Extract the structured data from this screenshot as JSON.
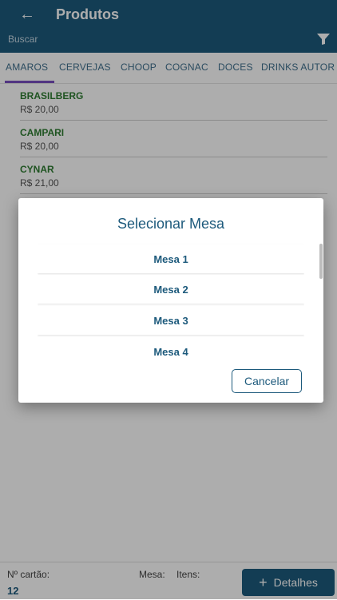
{
  "header": {
    "title": "Produtos",
    "back_icon": "←",
    "search_placeholder": "Buscar",
    "filter_icon": "filter-icon"
  },
  "tabs": [
    {
      "label": "AMAROS",
      "active": true
    },
    {
      "label": "CERVEJAS"
    },
    {
      "label": "CHOOP"
    },
    {
      "label": "COGNAC"
    },
    {
      "label": "DOCES"
    },
    {
      "label": "DRINKS AUTOR"
    }
  ],
  "products": [
    {
      "name": "BRASILBERG",
      "price": "R$ 20,00"
    },
    {
      "name": "CAMPARI",
      "price": "R$ 20,00"
    },
    {
      "name": "CYNAR",
      "price": "R$ 21,00"
    }
  ],
  "footer": {
    "cartao_label": "Nº cartão:",
    "cartao_value": "12",
    "mesa_label": "Mesa:",
    "itens_label": "Itens:",
    "detalhes_icon": "+",
    "detalhes_label": "Detalhes"
  },
  "dialog": {
    "title": "Selecionar Mesa",
    "options": [
      "Mesa 1",
      "Mesa 2",
      "Mesa 3",
      "Mesa 4"
    ],
    "cancel_label": "Cancelar"
  },
  "colors": {
    "primary": "#1d5a7c",
    "product_name": "#2e7d32",
    "tab_indicator": "#7a4fc0"
  }
}
